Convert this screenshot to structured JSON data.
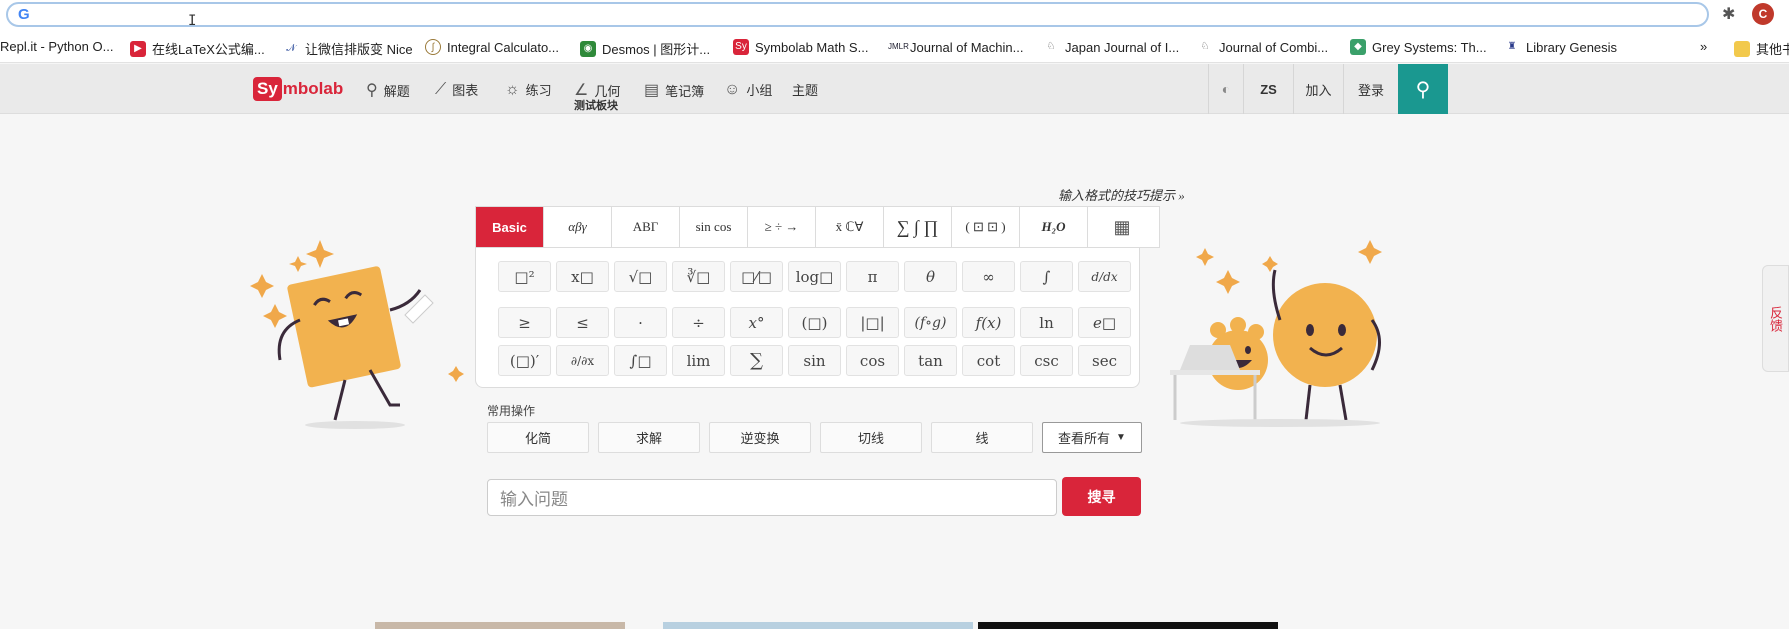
{
  "browser": {
    "google_glyph": "G",
    "profile_initial": "C"
  },
  "bookmarks": [
    {
      "label": "Repl.it - Python O..."
    },
    {
      "label": "在线LaTeX公式编..."
    },
    {
      "label": "让微信排版变 Nice"
    },
    {
      "label": "Integral Calculato..."
    },
    {
      "label": "Desmos | 图形计..."
    },
    {
      "label": "Symbolab Math S..."
    },
    {
      "label": "Journal of Machin..."
    },
    {
      "label": "Japan Journal of I..."
    },
    {
      "label": "Journal of Combi..."
    },
    {
      "label": "Grey Systems: Th..."
    },
    {
      "label": "Library Genesis"
    },
    {
      "label": "其他书"
    }
  ],
  "bookmark_more": "»",
  "nav": {
    "logo_sy": "Sy",
    "logo_rest": "mbolab",
    "items": [
      {
        "label": "解题"
      },
      {
        "label": "图表"
      },
      {
        "label": "练习"
      },
      {
        "label": "几何"
      },
      {
        "label": "笔记簿"
      },
      {
        "label": "小组"
      },
      {
        "label": "主题"
      }
    ],
    "sub_label": "测试板块",
    "right": [
      "ZS",
      "加入",
      "登录"
    ]
  },
  "keypad": {
    "tips": "输入格式的技巧提示 »",
    "tabs": [
      "Basic",
      "αβγ",
      "ABΓ",
      "sin cos",
      "≥ ÷ →",
      "x̄ ℂ∀",
      "∑ ∫ ∏",
      "( ⊡ ⊡ )",
      "H₂O",
      "calculator"
    ],
    "rows": [
      [
        "□²",
        "x□",
        "√□",
        "∛□",
        "□⁄□",
        "log□",
        "π",
        "θ",
        "∞",
        "∫",
        "d/dx"
      ],
      [
        "≥",
        "≤",
        "·",
        "÷",
        "x°",
        "(□)",
        "|□|",
        "(f∘g)",
        "f(x)",
        "ln",
        "e□"
      ],
      [
        "(□)′",
        "∂/∂x",
        "∫□",
        "lim",
        "∑",
        "sin",
        "cos",
        "tan",
        "cot",
        "csc",
        "sec"
      ]
    ]
  },
  "common": {
    "label": "常用操作",
    "ops": [
      "化简",
      "求解",
      "逆变换",
      "切线",
      "线"
    ],
    "view_all": "查看所有"
  },
  "search": {
    "placeholder": "输入问题",
    "button": "搜寻"
  },
  "feedback": "反馈"
}
